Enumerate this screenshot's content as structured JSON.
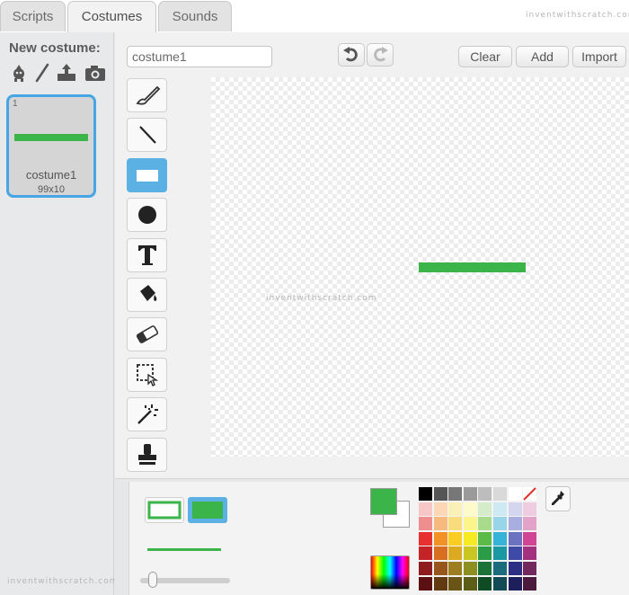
{
  "tabs": [
    {
      "label": "Scripts"
    },
    {
      "label": "Costumes"
    },
    {
      "label": "Sounds"
    }
  ],
  "watermark": "inventwithscratch.com",
  "left_panel": {
    "new_costume_label": "New costume:",
    "new_costume_icons": [
      "sprite-library-icon",
      "paint-brush-icon",
      "upload-icon",
      "camera-icon"
    ],
    "costume": {
      "number": "1",
      "name": "costume1",
      "size": "99x10"
    }
  },
  "editor": {
    "costume_name_value": "costume1",
    "buttons": {
      "clear": "Clear",
      "add": "Add",
      "import": "Import"
    },
    "tools": [
      "brush-tool-icon",
      "line-tool-icon",
      "rectangle-tool-icon",
      "ellipse-tool-icon",
      "text-tool-icon",
      "fill-tool-icon",
      "eraser-tool-icon",
      "select-tool-icon",
      "select-duplicate-tool-icon",
      "stamp-tool-icon"
    ],
    "active_tool": "rectangle-tool-icon",
    "shape_color": "#3bb54a"
  },
  "bottom": {
    "fill_modes": [
      "outline-rectangle",
      "filled-rectangle"
    ],
    "selected_fill_mode": "filled-rectangle",
    "stroke_color": "#3bb54a",
    "brush_size": 0.15,
    "primary_color": "#3bb54a",
    "secondary_color": "#ffffff",
    "palette": [
      "#000000",
      "#555555",
      "#777777",
      "#9a9a9a",
      "#bdbdbd",
      "#d9d9d9",
      "#ffffff",
      "transparent",
      "#f7c6c6",
      "#fbd7b5",
      "#fbf0b5",
      "#fdfbc9",
      "#d4ecc9",
      "#cde9f3",
      "#d4d6ef",
      "#f0cce0",
      "#ee8e8e",
      "#f6b97e",
      "#f9dc7e",
      "#fbf58c",
      "#a9db8d",
      "#98d5e9",
      "#a8aedf",
      "#e3a2c8",
      "#e8312e",
      "#f29226",
      "#fbcd23",
      "#f6ea23",
      "#5bbb47",
      "#36b3d6",
      "#6b72bf",
      "#d04594",
      "#c42427",
      "#d86f20",
      "#dcaa21",
      "#c9c622",
      "#2b9b48",
      "#1a99a3",
      "#3e4aa5",
      "#a3317f",
      "#8e1c1f",
      "#98561c",
      "#9c7d1f",
      "#8e8f23",
      "#1b7338",
      "#1b6d7d",
      "#2c2f84",
      "#72285d",
      "#5b1012",
      "#613a12",
      "#6a5416",
      "#5c5e18",
      "#0f4b24",
      "#124b56",
      "#1d1e5c",
      "#4c1a3d"
    ]
  }
}
